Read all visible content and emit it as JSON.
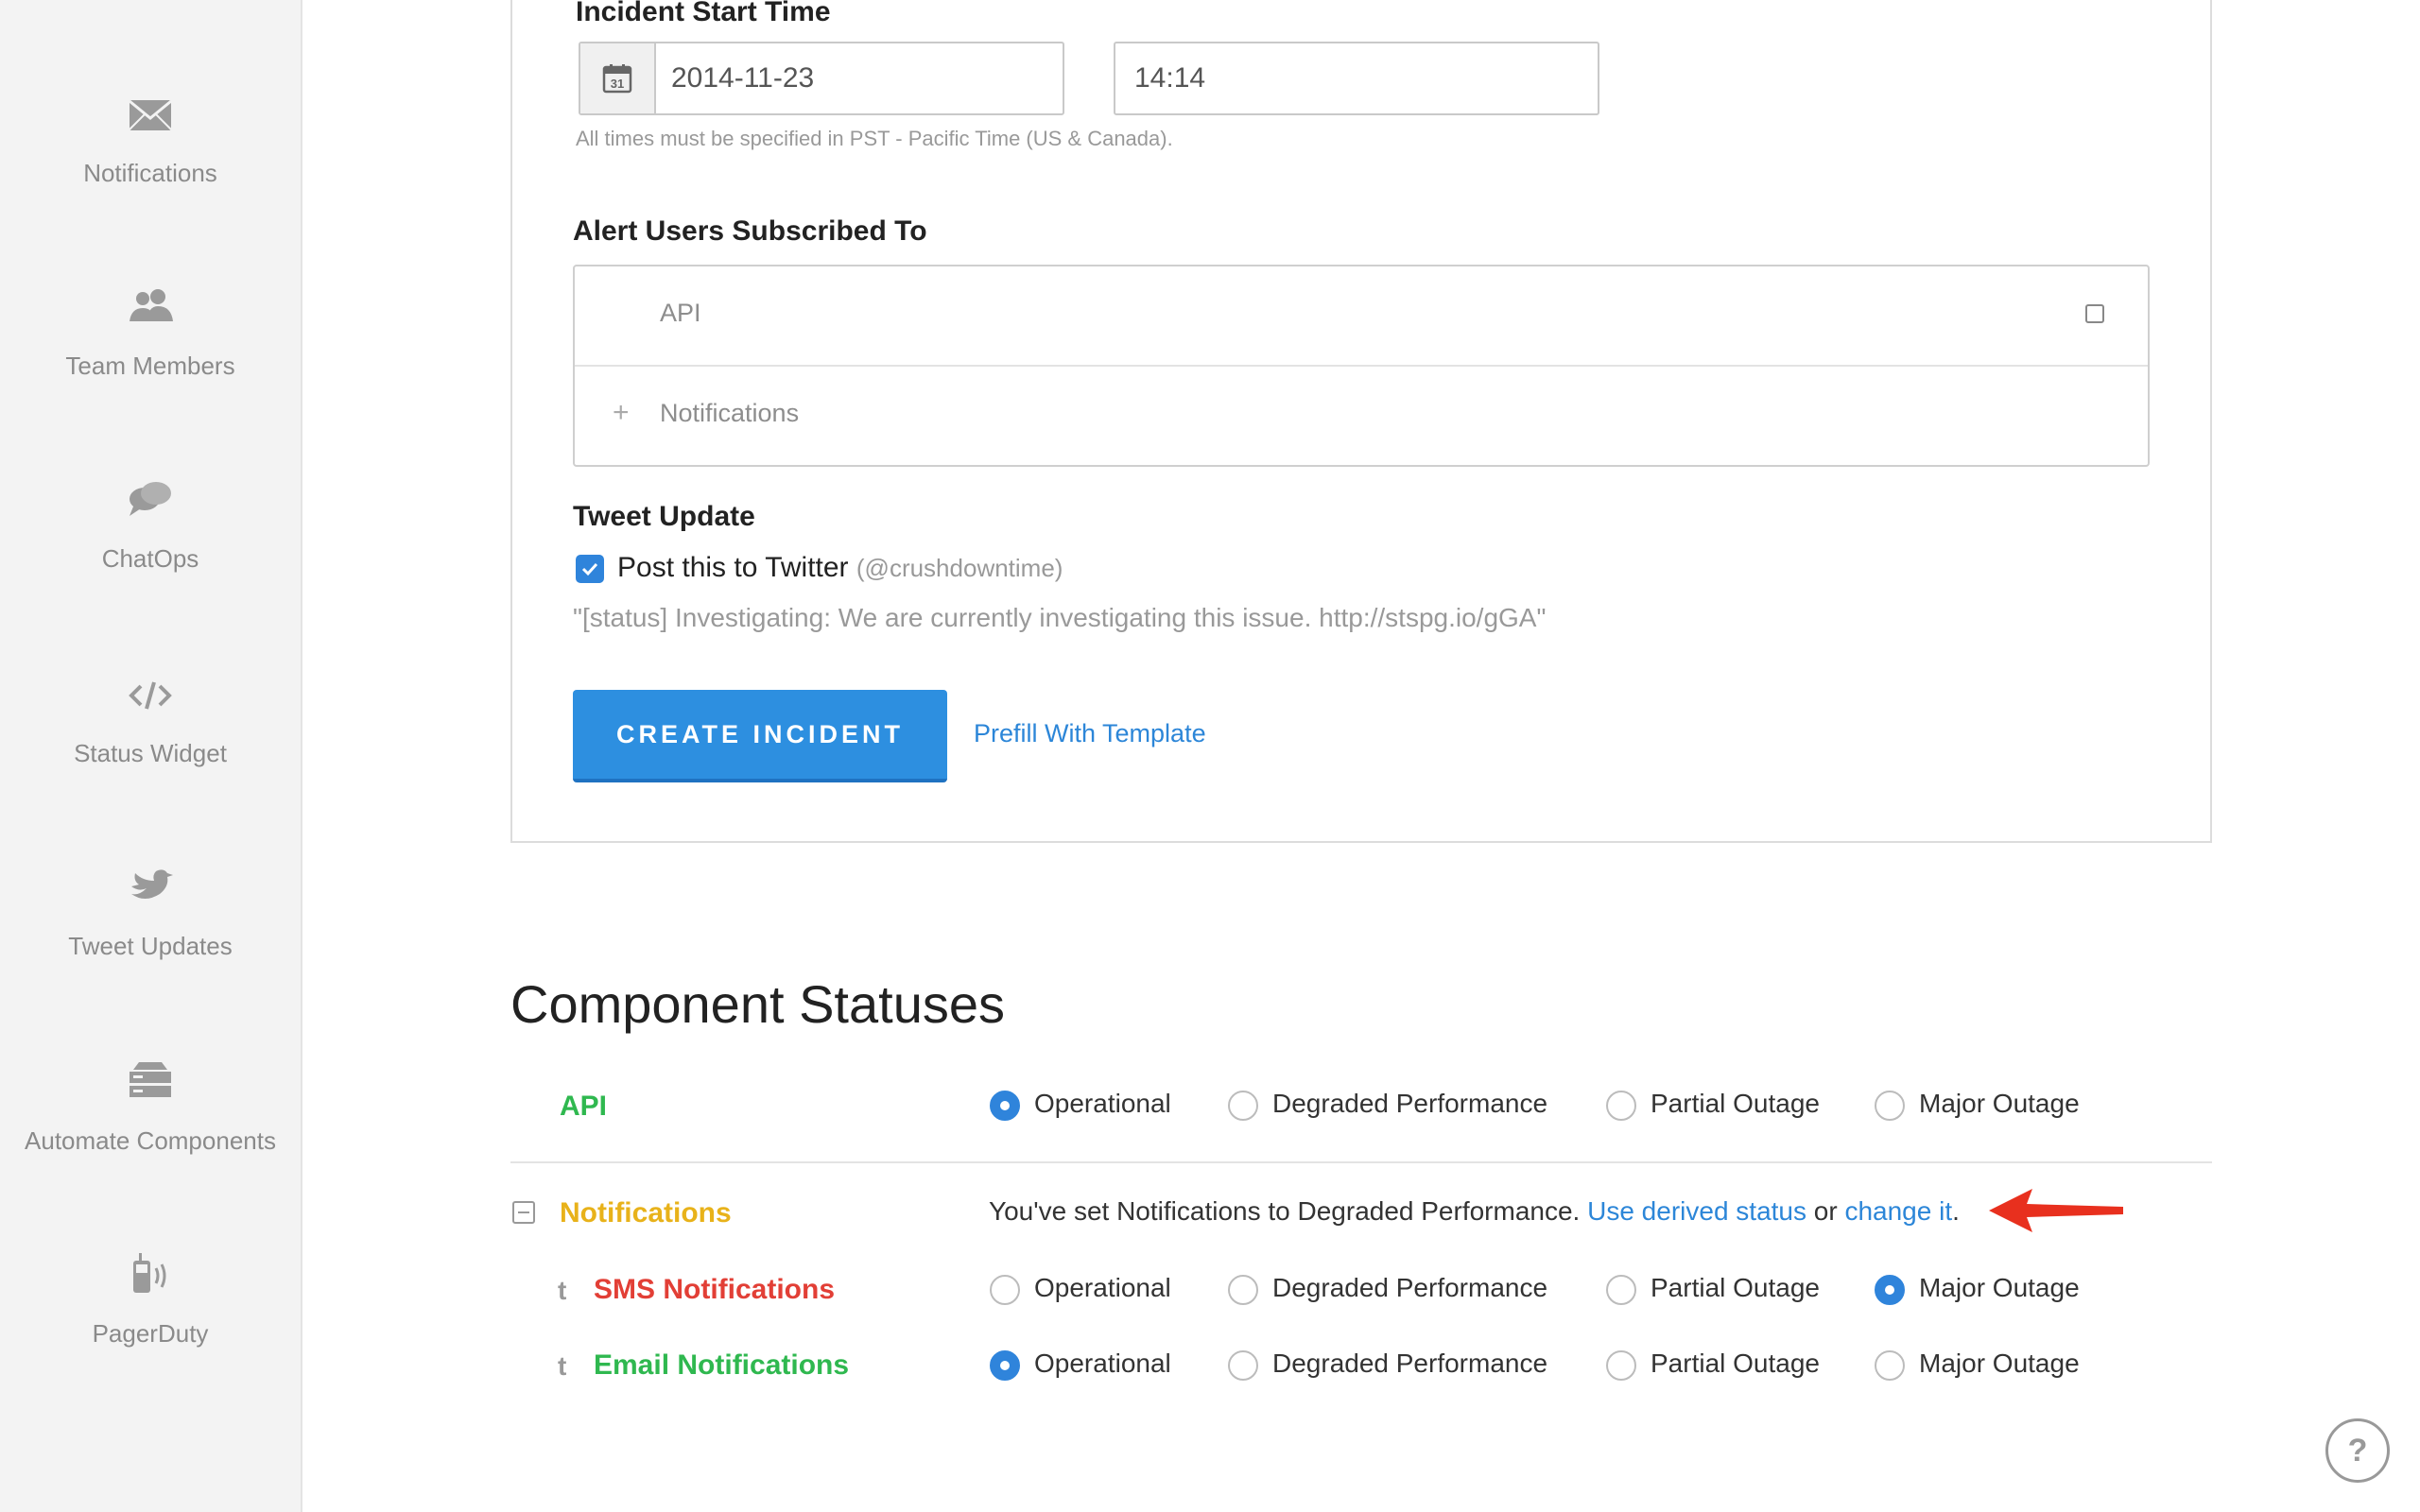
{
  "sidebar": {
    "items": [
      {
        "label": "Notifications",
        "icon": "envelope-icon"
      },
      {
        "label": "Team Members",
        "icon": "team-icon"
      },
      {
        "label": "ChatOps",
        "icon": "chat-bubbles-icon"
      },
      {
        "label": "Status Widget",
        "icon": "code-icon"
      },
      {
        "label": "Tweet Updates",
        "icon": "twitter-bird-icon"
      },
      {
        "label": "Automate Components",
        "icon": "server-icon"
      },
      {
        "label": "PagerDuty",
        "icon": "pager-icon"
      }
    ]
  },
  "incident_form": {
    "start_time_label": "Incident Start Time",
    "date_value": "2014-11-23",
    "time_value": "14:14",
    "timezone_hint": "All times must be specified in PST - Pacific Time (US & Canada).",
    "alert_label": "Alert Users Subscribed To",
    "alert_components": [
      {
        "name": "API",
        "prefix": "",
        "checked": false
      },
      {
        "name": "Notifications",
        "prefix": "+",
        "checked": false
      }
    ],
    "tweet_label": "Tweet Update",
    "tweet_checkbox_label": "Post this to Twitter",
    "tweet_handle": "(@crushdowntime)",
    "tweet_checked": true,
    "tweet_preview": "\"[status] Investigating: We are currently investigating this issue. http://stspg.io/gGA\"",
    "create_button": "CREATE INCIDENT",
    "prefill_link": "Prefill With Template"
  },
  "component_statuses": {
    "title": "Component Statuses",
    "options": [
      "Operational",
      "Degraded Performance",
      "Partial Outage",
      "Major Outage"
    ],
    "api": {
      "name": "API",
      "color": "#2fb84f",
      "selected": "Operational"
    },
    "notifications": {
      "name": "Notifications",
      "color": "#e8b21a",
      "derived_text": "You've set Notifications to Degraded Performance.",
      "derived_link": "Use derived status",
      "derived_or": "or",
      "change_link": "change it",
      "period": "."
    },
    "sms": {
      "name": "SMS Notifications",
      "color": "#e23f36",
      "selected": "Major Outage",
      "prefix": "t"
    },
    "email": {
      "name": "Email Notifications",
      "color": "#2fb84f",
      "selected": "Operational",
      "prefix": "t"
    }
  },
  "help_button": "?",
  "colors": {
    "primary": "#2d8fe0",
    "link": "#2c86d8",
    "arrow": "#e8301e"
  }
}
